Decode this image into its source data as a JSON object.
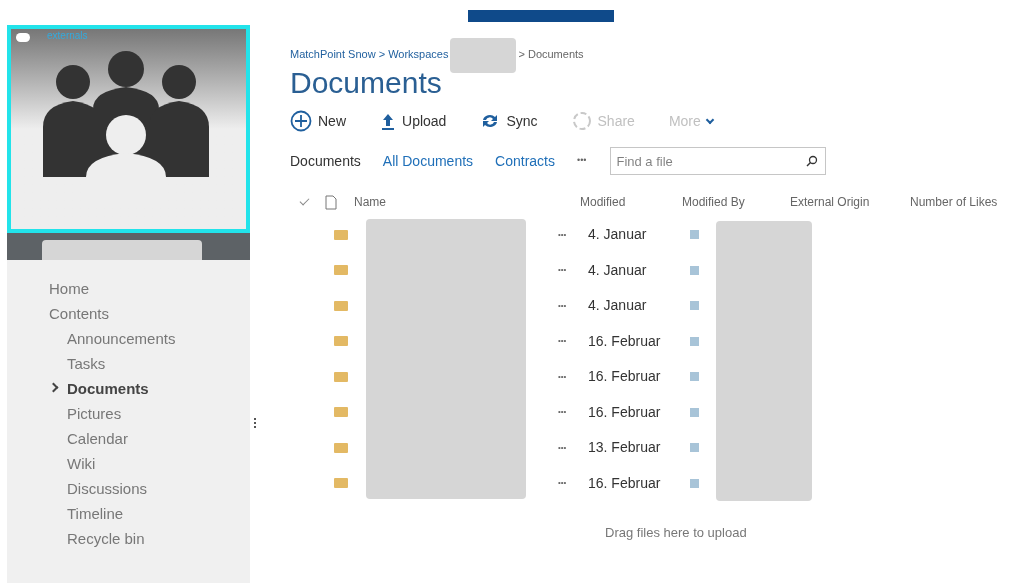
{
  "site_logo": {
    "label": "externals"
  },
  "navigation": [
    {
      "label": "Home",
      "selected": false
    },
    {
      "label": "Contents",
      "selected": false,
      "children": [
        {
          "label": "Announcements",
          "selected": false
        },
        {
          "label": "Tasks",
          "selected": false
        },
        {
          "label": "Documents",
          "selected": true
        },
        {
          "label": "Pictures",
          "selected": false
        },
        {
          "label": "Calendar",
          "selected": false
        },
        {
          "label": "Wiki",
          "selected": false
        },
        {
          "label": "Discussions",
          "selected": false
        },
        {
          "label": "Timeline",
          "selected": false
        },
        {
          "label": "Recycle bin",
          "selected": false
        }
      ]
    }
  ],
  "breadcrumb": {
    "first": "MatchPoint Snow > Workspaces",
    "last": "> Documents"
  },
  "title": "Documents",
  "toolbar": [
    {
      "label": "New",
      "kind": "new",
      "disabled": false
    },
    {
      "label": "Upload",
      "kind": "upload",
      "disabled": false
    },
    {
      "label": "Sync",
      "kind": "sync",
      "disabled": false
    },
    {
      "label": "Share",
      "kind": "share",
      "disabled": true
    },
    {
      "label": "More",
      "kind": "more",
      "disabled": true
    }
  ],
  "views": [
    {
      "label": "Documents",
      "selected": true
    },
    {
      "label": "All Documents",
      "selected": false
    },
    {
      "label": "Contracts",
      "selected": false
    }
  ],
  "views_more": "•••",
  "search": {
    "placeholder": "Find a file"
  },
  "table": {
    "columns": [
      "Name",
      "Modified",
      "Modified By",
      "External Origin",
      "Number of Likes"
    ],
    "rows": [
      {
        "menu": "•••",
        "modified": "4. Januar"
      },
      {
        "menu": "•••",
        "modified": "4. Januar"
      },
      {
        "menu": "•••",
        "modified": "4. Januar"
      },
      {
        "menu": "•••",
        "modified": "16. Februar"
      },
      {
        "menu": "•••",
        "modified": "16. Februar"
      },
      {
        "menu": "•••",
        "modified": "16. Februar"
      },
      {
        "menu": "•••",
        "modified": "13. Februar"
      },
      {
        "menu": "•••",
        "modified": "16. Februar"
      }
    ]
  },
  "drop_hint": "Drag files here to upload"
}
